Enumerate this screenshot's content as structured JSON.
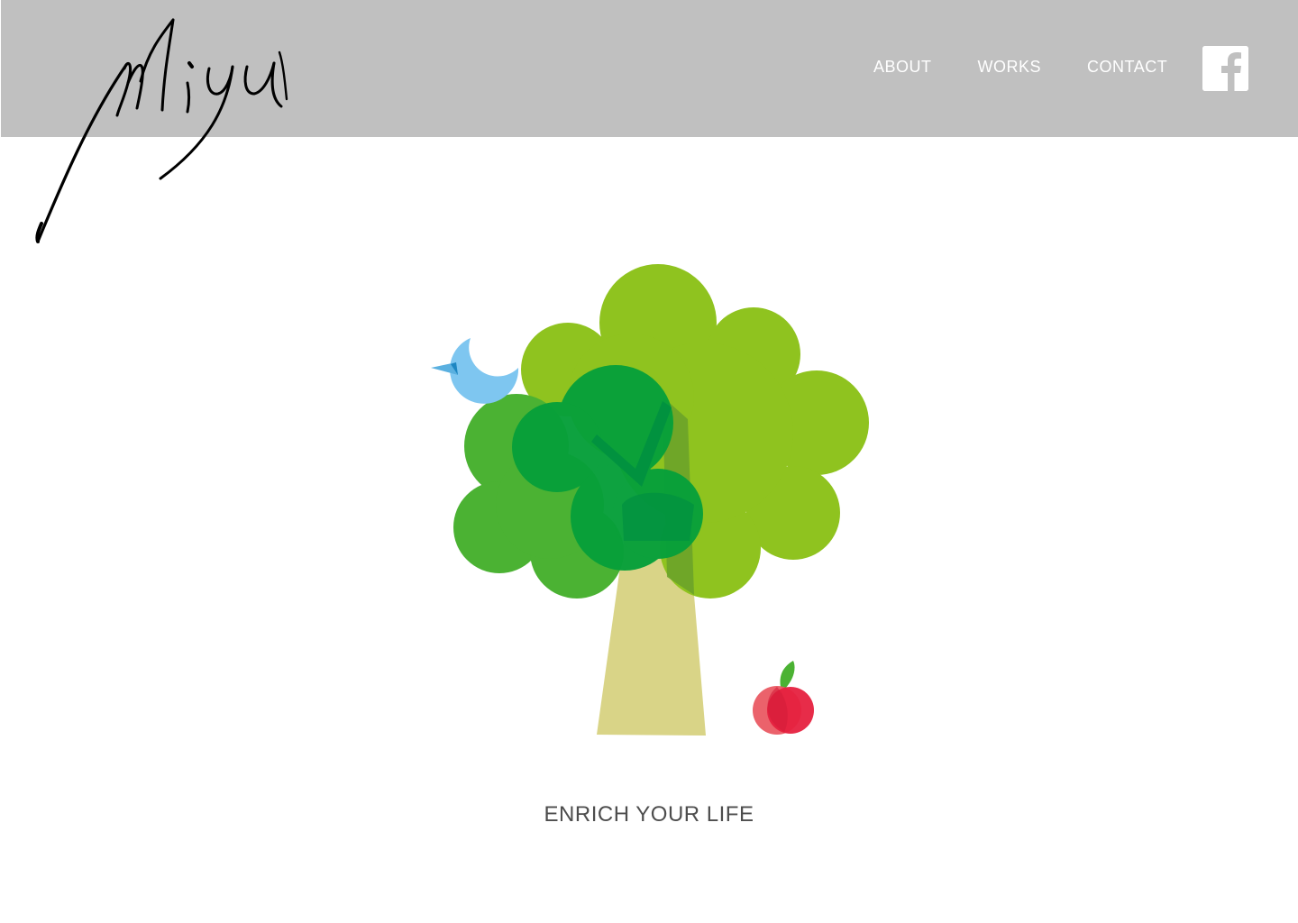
{
  "brand": {
    "logo_text": "Miyu"
  },
  "nav": {
    "items": [
      {
        "label": "ABOUT"
      },
      {
        "label": "WORKS"
      },
      {
        "label": "CONTACT"
      }
    ],
    "social_icon": "facebook-icon"
  },
  "hero": {
    "illustration": "tree-icon",
    "tagline": "ENRICH YOUR LIFE"
  },
  "colors": {
    "header_bg": "#c0c0c0",
    "nav_text": "#ffffff",
    "tagline_text": "#4d4d4d",
    "leaf_light": "#8fc31f",
    "leaf_mid": "#4bb233",
    "leaf_dark": "#00a03c",
    "trunk": "#d9d487",
    "bird": "#7ec6f0",
    "apple": "#e6213f"
  }
}
